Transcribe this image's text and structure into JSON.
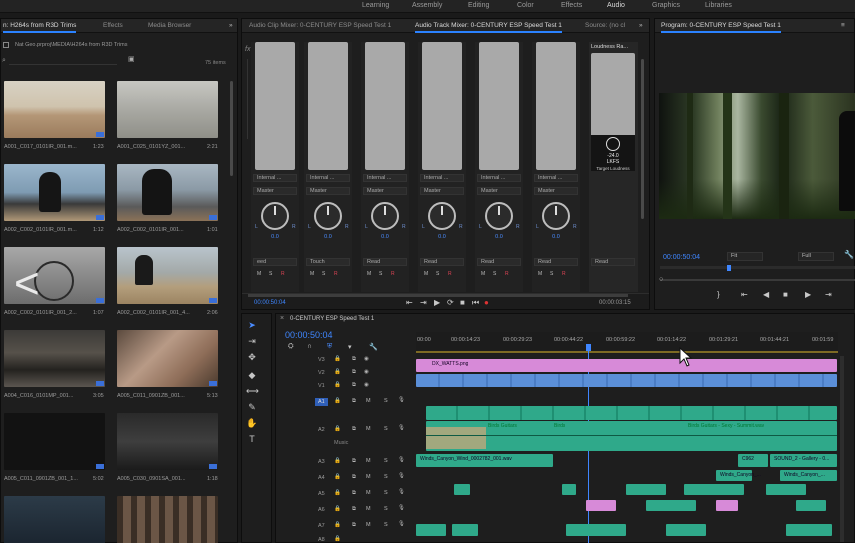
{
  "workspaces": [
    "Learning",
    "Assembly",
    "Editing",
    "Color",
    "Effects",
    "Audio",
    "Graphics",
    "Libraries"
  ],
  "active_workspace": "Audio",
  "project": {
    "tabs": [
      "n: H264s from R3D Trims",
      "Effects",
      "Media Browser"
    ],
    "path": "Nat Geo.prproj\\MEDIA\\H264s from R3D Trims",
    "item_count": "75 items",
    "clips": [
      {
        "name": "A001_C017_0101IR_001.m...",
        "dur": "1:23"
      },
      {
        "name": "A001_C025_0101YZ_001...",
        "dur": "2:21"
      },
      {
        "name": "A002_C002_0101IR_001.m...",
        "dur": "1:12"
      },
      {
        "name": "A002_C002_0101IR_001...",
        "dur": "1:01"
      },
      {
        "name": "A002_C002_0101IR_001_2...",
        "dur": "1:07"
      },
      {
        "name": "A002_C002_0101IR_001_4...",
        "dur": "2:06"
      },
      {
        "name": "A004_C016_0101MP_001...",
        "dur": "3:05"
      },
      {
        "name": "A005_C011_0901ZB_001...",
        "dur": "5:13"
      },
      {
        "name": "A005_C011_0901ZB_001_1...",
        "dur": "5:02"
      },
      {
        "name": "A005_C030_0901SA_001...",
        "dur": "1:18"
      }
    ]
  },
  "mixer": {
    "tabs": [
      "Audio Clip Mixer: 0-CENTURY ESP Speed Test 1",
      "Audio Track Mixer: 0-CENTURY ESP Speed Test 1",
      "Source: (no cl"
    ],
    "channels": [
      {
        "input": "Internal ...",
        "output": "Master",
        "value": "0.0",
        "mode": "eed"
      },
      {
        "input": "Internal ...",
        "output": "Master",
        "value": "0.0",
        "mode": "Touch"
      },
      {
        "input": "Internal ...",
        "output": "Master",
        "value": "0.0",
        "mode": "Read"
      },
      {
        "input": "Internal ...",
        "output": "Master",
        "value": "0.0",
        "mode": "Read"
      },
      {
        "input": "Internal ...",
        "output": "Master",
        "value": "0.0",
        "mode": "Read"
      },
      {
        "input": "Internal ...",
        "output": "Master",
        "value": "0.0",
        "mode": "Read"
      }
    ],
    "master_mode": "Read",
    "loudness": {
      "title": "Loudness Ra...",
      "value": "-24.0",
      "unit": "LKFS",
      "label": "Target Loudness"
    },
    "timecode_left": "00:00:50:04",
    "timecode_right": "00:00:03:15",
    "msr_labels": [
      "M",
      "S",
      "R"
    ]
  },
  "program": {
    "title": "Program: 0-CENTURY ESP Speed Test 1",
    "timecode": "00:00:50:04",
    "fit": "Fit",
    "quality": "Full"
  },
  "timeline": {
    "tab": "0-CENTURY ESP Speed Test 1",
    "timecode": "00:00:50:04",
    "ruler": [
      "00:00",
      "00:00:14:23",
      "00:00:29:23",
      "00:00:44:22",
      "00:00:59:22",
      "00:01:14:22",
      "00:01:29:21",
      "00:01:44:21",
      "00:01:59"
    ],
    "tracks": [
      "V3",
      "V2",
      "V1",
      "A1",
      "A2",
      "A3",
      "A4",
      "A5",
      "A6",
      "A7",
      "A8"
    ],
    "a2_label": "Music",
    "clips": {
      "graphic": "DX_WATTS.png",
      "music_1": "Birds Guitars",
      "music_2": "Birds",
      "music_3": "Birds Guitars - Sexy - Summit.wav",
      "a3_1": "Winds_Canyon_Wind_0002782_001.wav",
      "a3_2": "C962",
      "a3_3": "SOUND_2 - Gallery - 0...",
      "a3_4": "Winds_Canyon_...",
      "a3_5": "Winds_Canyon_..."
    }
  },
  "nav": {
    "prev_label": "<"
  }
}
